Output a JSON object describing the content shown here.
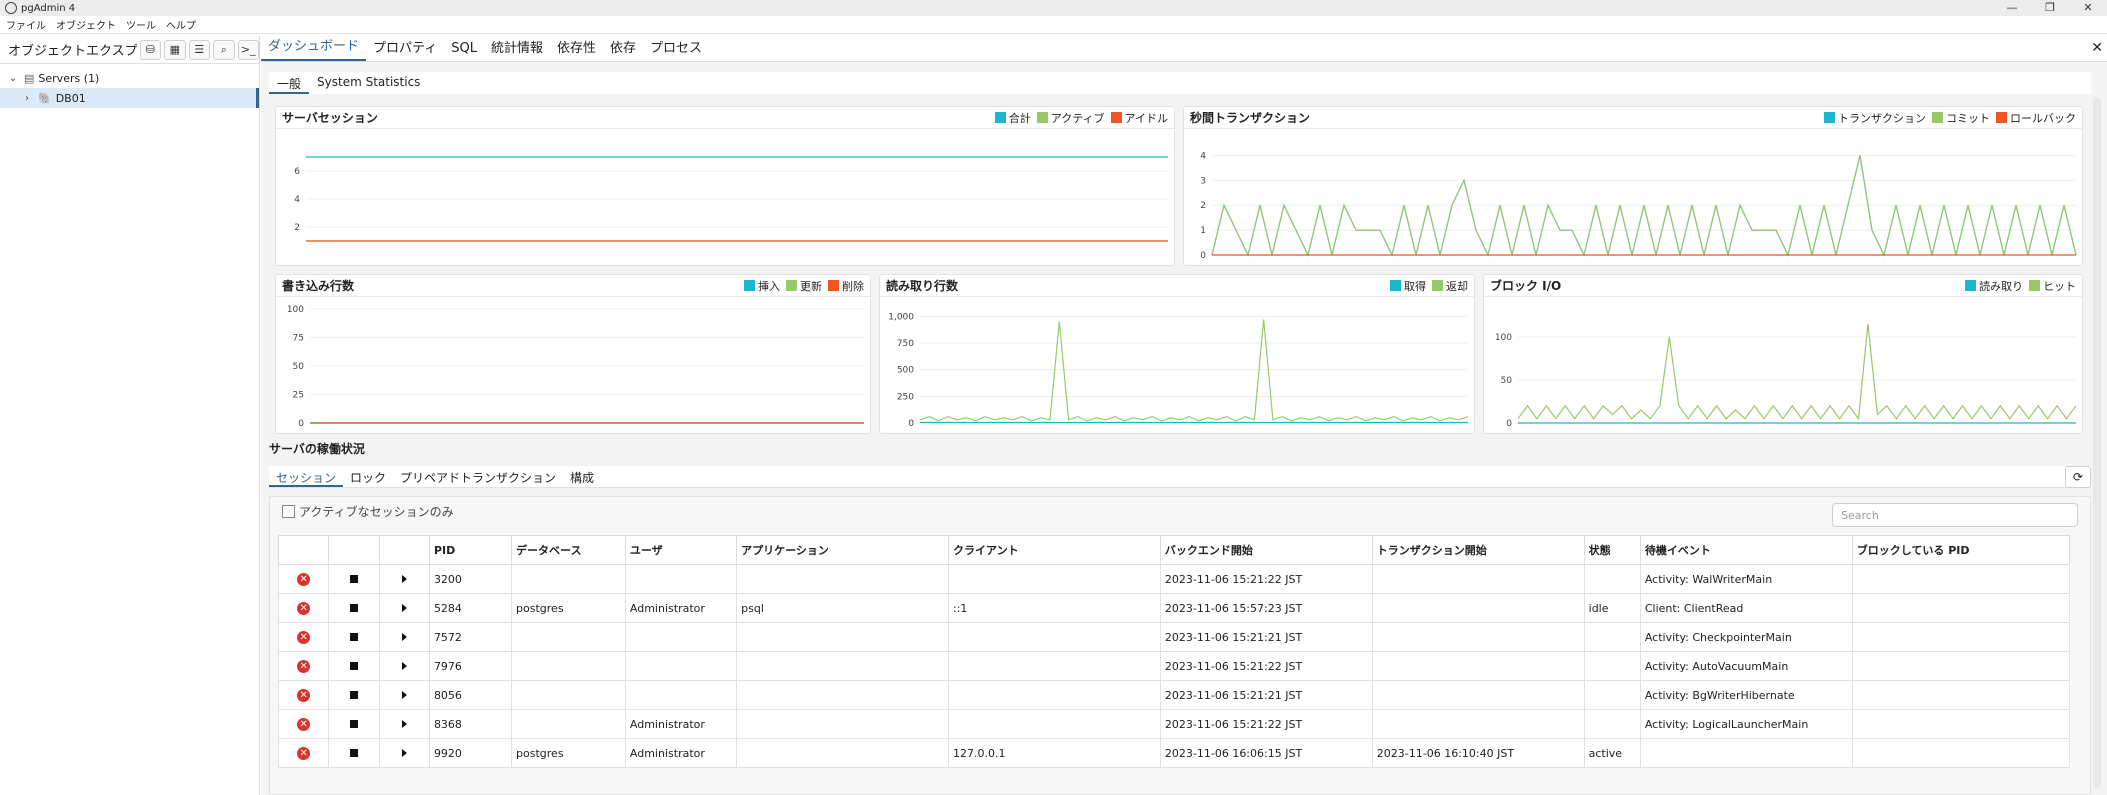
{
  "window": {
    "title": "pgAdmin 4"
  },
  "menu": [
    "ファイル",
    "オブジェクト",
    "ツール",
    "ヘルプ"
  ],
  "explorer": {
    "title": "オブジェクトエクスプロ",
    "toolbar_icons": [
      "query-tool-icon",
      "table-icon",
      "filter-icon",
      "search-icon",
      "terminal-icon"
    ],
    "tree": [
      {
        "label": "Servers (1)",
        "icon": "servers-icon"
      },
      {
        "label": "DB01",
        "icon": "elephant-icon"
      }
    ]
  },
  "tabs": [
    "ダッシュボード",
    "プロパティ",
    "SQL",
    "統計情報",
    "依存性",
    "依存",
    "プロセス"
  ],
  "subtabs": [
    "一般",
    "System Statistics"
  ],
  "colors": {
    "cyan": "#1ab7cf",
    "green": "#97c96b",
    "orange": "#f05523",
    "accent": "#326690"
  },
  "panels": {
    "sessions": {
      "title": "サーバセッション",
      "legend": [
        "合計",
        "アクティブ",
        "アイドル"
      ]
    },
    "tps": {
      "title": "秒間トランザクション",
      "legend": [
        "トランザクション",
        "コミット",
        "ロールバック"
      ]
    },
    "writes": {
      "title": "書き込み行数",
      "legend": [
        "挿入",
        "更新",
        "削除"
      ]
    },
    "reads": {
      "title": "読み取り行数",
      "legend": [
        "取得",
        "返却"
      ]
    },
    "blockio": {
      "title": "ブロック I/O",
      "legend": [
        "読み取り",
        "ヒット"
      ]
    }
  },
  "chart_data": [
    {
      "type": "line",
      "title": "サーバセッション",
      "ylim": [
        0,
        8
      ],
      "yticks": [
        "2",
        "4",
        "6"
      ],
      "series": [
        {
          "name": "合計",
          "values": [
            7,
            7,
            7,
            7,
            7,
            7,
            7,
            7,
            7,
            7,
            7,
            7,
            7,
            7,
            7,
            7,
            7,
            7,
            7,
            7,
            7,
            7,
            7,
            7,
            7,
            7,
            7,
            7,
            7,
            7,
            7,
            7,
            7,
            7,
            7,
            7,
            7,
            7,
            7,
            7,
            7,
            7,
            7,
            7,
            7,
            7,
            7,
            7,
            7,
            7,
            7,
            7,
            7,
            7,
            7,
            7,
            7,
            7,
            7,
            7
          ]
        },
        {
          "name": "アクティブ",
          "values": [
            1,
            1,
            1,
            1,
            1,
            1,
            1,
            1,
            1,
            1,
            1,
            1,
            1,
            1,
            1,
            1,
            1,
            1,
            1,
            1,
            1,
            1,
            1,
            1,
            1,
            1,
            1,
            1,
            1,
            1,
            1,
            1,
            1,
            1,
            1,
            1,
            1,
            1,
            1,
            1,
            1,
            1,
            1,
            1,
            1,
            1,
            1,
            1,
            1,
            1,
            1,
            1,
            1,
            1,
            1,
            1,
            1,
            1,
            1,
            1
          ]
        },
        {
          "name": "アイドル",
          "values": [
            1,
            1,
            1,
            1,
            1,
            1,
            1,
            1,
            1,
            1,
            1,
            1,
            1,
            1,
            1,
            1,
            1,
            1,
            1,
            1,
            1,
            1,
            1,
            1,
            1,
            1,
            1,
            1,
            1,
            1,
            1,
            1,
            1,
            1,
            1,
            1,
            1,
            1,
            1,
            1,
            1,
            1,
            1,
            1,
            1,
            1,
            1,
            1,
            1,
            1,
            1,
            1,
            1,
            1,
            1,
            1,
            1,
            1,
            1,
            1
          ]
        }
      ]
    },
    {
      "type": "line",
      "title": "秒間トランザクション",
      "ylim": [
        0,
        4.5
      ],
      "yticks": [
        "0",
        "1",
        "2",
        "3",
        "4"
      ],
      "series": [
        {
          "name": "トランザクション",
          "values": [
            0,
            2,
            1,
            0,
            2,
            0,
            2,
            1,
            0,
            2,
            0,
            2,
            1,
            1,
            1,
            0,
            2,
            0,
            2,
            0,
            2,
            3,
            1,
            0,
            2,
            0,
            2,
            0,
            2,
            1,
            1,
            0,
            2,
            0,
            2,
            0,
            2,
            0,
            2,
            0,
            2,
            0,
            2,
            0,
            2,
            1,
            1,
            1,
            0,
            2,
            0,
            2,
            0,
            2,
            4,
            1,
            0,
            2,
            0,
            2,
            0,
            2,
            0,
            2,
            0,
            2,
            0,
            2,
            0,
            2,
            0,
            2,
            0
          ]
        },
        {
          "name": "コミット",
          "values": [
            0,
            2,
            1,
            0,
            2,
            0,
            2,
            1,
            0,
            2,
            0,
            2,
            1,
            1,
            1,
            0,
            2,
            0,
            2,
            0,
            2,
            3,
            1,
            0,
            2,
            0,
            2,
            0,
            2,
            1,
            1,
            0,
            2,
            0,
            2,
            0,
            2,
            0,
            2,
            0,
            2,
            0,
            2,
            0,
            2,
            1,
            1,
            1,
            0,
            2,
            0,
            2,
            0,
            2,
            4,
            1,
            0,
            2,
            0,
            2,
            0,
            2,
            0,
            2,
            0,
            2,
            0,
            2,
            0,
            2,
            0,
            2,
            0
          ]
        },
        {
          "name": "ロールバック",
          "values": [
            0,
            0,
            0,
            0,
            0,
            0,
            0,
            0,
            0,
            0,
            0,
            0,
            0,
            0,
            0,
            0,
            0,
            0,
            0,
            0,
            0,
            0,
            0,
            0,
            0,
            0,
            0,
            0,
            0,
            0,
            0,
            0,
            0,
            0,
            0,
            0,
            0,
            0,
            0,
            0,
            0,
            0,
            0,
            0,
            0,
            0,
            0,
            0,
            0,
            0,
            0,
            0,
            0,
            0,
            0,
            0,
            0,
            0,
            0,
            0,
            0,
            0,
            0,
            0,
            0,
            0,
            0,
            0,
            0,
            0,
            0,
            0,
            0
          ]
        }
      ]
    },
    {
      "type": "line",
      "title": "書き込み行数",
      "ylim": [
        0,
        100
      ],
      "yticks": [
        "0",
        "25",
        "50",
        "75",
        "100"
      ],
      "series": [
        {
          "name": "挿入",
          "values": [
            0,
            0,
            0,
            0,
            0,
            0,
            0,
            0,
            0,
            0,
            0,
            0,
            0,
            0,
            0,
            0,
            0,
            0,
            0,
            0
          ]
        },
        {
          "name": "更新",
          "values": [
            0,
            0,
            0,
            0,
            0,
            0,
            0,
            0,
            0,
            0,
            0,
            0,
            0,
            0,
            0,
            0,
            0,
            0,
            0,
            0
          ]
        },
        {
          "name": "削除",
          "values": [
            0,
            0,
            0,
            0,
            0,
            0,
            0,
            0,
            0,
            0,
            0,
            0,
            0,
            0,
            0,
            0,
            0,
            0,
            0,
            0
          ]
        }
      ]
    },
    {
      "type": "line",
      "title": "読み取り行数",
      "ylim": [
        0,
        1050
      ],
      "yticks": [
        "0",
        "250",
        "500",
        "750",
        "1,000"
      ],
      "series": [
        {
          "name": "取得",
          "values": [
            5,
            5,
            5,
            5,
            5,
            5,
            5,
            5,
            5,
            5,
            5,
            5,
            5,
            5,
            5,
            5,
            5,
            5,
            5,
            5,
            5,
            5,
            5,
            5,
            5,
            5,
            5,
            5,
            5,
            5,
            5,
            5,
            5,
            5,
            5,
            5,
            5,
            5,
            5,
            5,
            5,
            5,
            5,
            5,
            5,
            5,
            5,
            5,
            5,
            5,
            5,
            5,
            5,
            5,
            5,
            5,
            5,
            5,
            5,
            5
          ]
        },
        {
          "name": "返却",
          "values": [
            30,
            60,
            20,
            60,
            30,
            50,
            20,
            60,
            30,
            50,
            30,
            60,
            20,
            50,
            30,
            950,
            30,
            60,
            20,
            50,
            30,
            60,
            20,
            50,
            30,
            60,
            20,
            50,
            30,
            60,
            20,
            50,
            30,
            60,
            20,
            60,
            30,
            970,
            30,
            60,
            20,
            50,
            30,
            60,
            20,
            50,
            30,
            60,
            20,
            50,
            30,
            60,
            20,
            50,
            30,
            60,
            20,
            50,
            30,
            60
          ]
        }
      ]
    },
    {
      "type": "line",
      "title": "ブロック I/O",
      "ylim": [
        0,
        130
      ],
      "yticks": [
        "0",
        "50",
        "100"
      ],
      "series": [
        {
          "name": "読み取り",
          "values": [
            0,
            0,
            0,
            0,
            0,
            0,
            0,
            0,
            0,
            0,
            0,
            0,
            0,
            0,
            0,
            0,
            0,
            0,
            0,
            0,
            0,
            0,
            0,
            0,
            0,
            0,
            0,
            0,
            0,
            0,
            0,
            0,
            0,
            0,
            0,
            0,
            0,
            0,
            0,
            0,
            0,
            0,
            0,
            0,
            0,
            0,
            0,
            0,
            0,
            0,
            0,
            0,
            0,
            0,
            0,
            0,
            0,
            0,
            0,
            0
          ]
        },
        {
          "name": "ヒット",
          "values": [
            5,
            20,
            5,
            20,
            5,
            20,
            5,
            20,
            5,
            20,
            10,
            20,
            5,
            15,
            5,
            20,
            100,
            20,
            5,
            20,
            5,
            20,
            5,
            15,
            5,
            20,
            5,
            20,
            5,
            20,
            5,
            20,
            5,
            20,
            5,
            20,
            5,
            115,
            10,
            20,
            5,
            20,
            5,
            20,
            5,
            20,
            5,
            20,
            5,
            20,
            5,
            20,
            5,
            20,
            5,
            20,
            5,
            20,
            5,
            20
          ]
        }
      ]
    }
  ],
  "activity": {
    "title": "サーバの稼働状況",
    "tabs": [
      "セッション",
      "ロック",
      "プリペアドトランザクション",
      "構成"
    ],
    "active_only_label": "アクティブなセッションのみ",
    "search_placeholder": "Search",
    "columns": [
      "PID",
      "データベース",
      "ユーザ",
      "アプリケーション",
      "クライアント",
      "バックエンド開始",
      "トランザクション開始",
      "状態",
      "待機イベント",
      "ブロックしている PID"
    ],
    "rows": [
      [
        "3200",
        "",
        "",
        "",
        "",
        "2023-11-06 15:21:22 JST",
        "",
        "",
        "Activity: WalWriterMain",
        ""
      ],
      [
        "5284",
        "postgres",
        "Administrator",
        "psql",
        "::1",
        "2023-11-06 15:57:23 JST",
        "",
        "idle",
        "Client: ClientRead",
        ""
      ],
      [
        "7572",
        "",
        "",
        "",
        "",
        "2023-11-06 15:21:21 JST",
        "",
        "",
        "Activity: CheckpointerMain",
        ""
      ],
      [
        "7976",
        "",
        "",
        "",
        "",
        "2023-11-06 15:21:22 JST",
        "",
        "",
        "Activity: AutoVacuumMain",
        ""
      ],
      [
        "8056",
        "",
        "",
        "",
        "",
        "2023-11-06 15:21:21 JST",
        "",
        "",
        "Activity: BgWriterHibernate",
        ""
      ],
      [
        "8368",
        "",
        "Administrator",
        "",
        "",
        "2023-11-06 15:21:22 JST",
        "",
        "",
        "Activity: LogicalLauncherMain",
        ""
      ],
      [
        "9920",
        "postgres",
        "Administrator",
        "",
        "127.0.0.1",
        "2023-11-06 16:06:15 JST",
        "2023-11-06 16:10:40 JST",
        "active",
        "",
        ""
      ]
    ]
  }
}
